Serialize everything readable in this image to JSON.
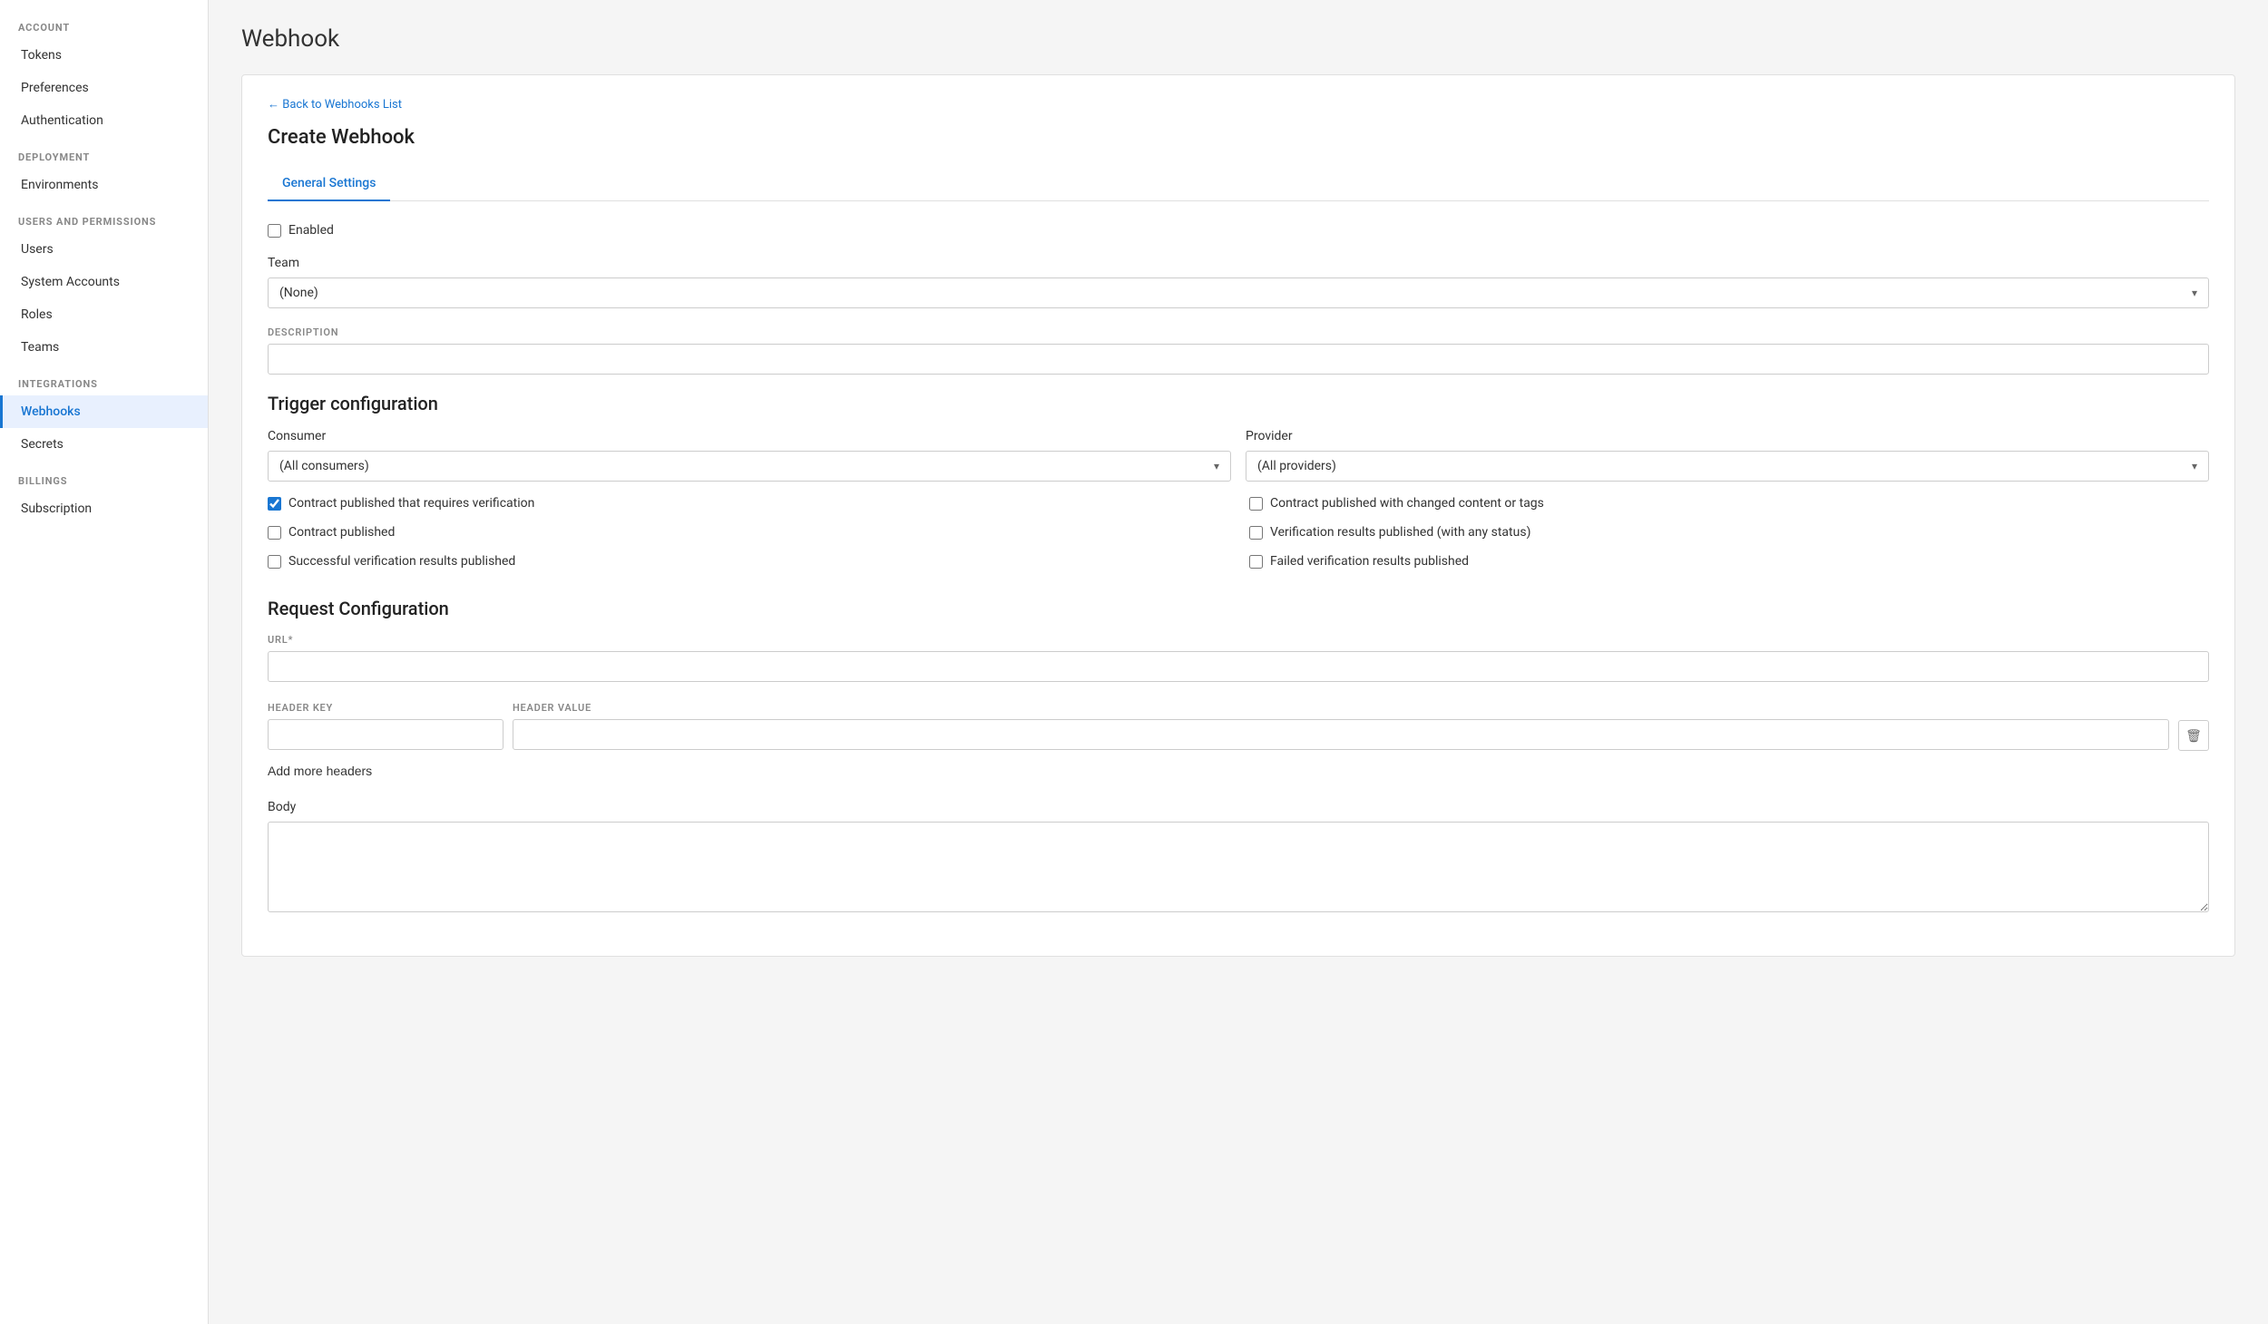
{
  "sidebar": {
    "sections": [
      {
        "label": "ACCOUNT",
        "items": [
          {
            "id": "tokens",
            "label": "Tokens",
            "active": false
          },
          {
            "id": "preferences",
            "label": "Preferences",
            "active": false
          },
          {
            "id": "authentication",
            "label": "Authentication",
            "active": false
          }
        ]
      },
      {
        "label": "DEPLOYMENT",
        "items": [
          {
            "id": "environments",
            "label": "Environments",
            "active": false
          }
        ]
      },
      {
        "label": "USERS AND PERMISSIONS",
        "items": [
          {
            "id": "users",
            "label": "Users",
            "active": false
          },
          {
            "id": "system-accounts",
            "label": "System Accounts",
            "active": false
          },
          {
            "id": "roles",
            "label": "Roles",
            "active": false
          },
          {
            "id": "teams",
            "label": "Teams",
            "active": false
          }
        ]
      },
      {
        "label": "INTEGRATIONS",
        "items": [
          {
            "id": "webhooks",
            "label": "Webhooks",
            "active": true
          },
          {
            "id": "secrets",
            "label": "Secrets",
            "active": false
          }
        ]
      },
      {
        "label": "BILLINGS",
        "items": [
          {
            "id": "subscription",
            "label": "Subscription",
            "active": false
          }
        ]
      }
    ]
  },
  "page": {
    "title": "Webhook",
    "back_link": "← Back to Webhooks List",
    "create_title": "Create Webhook"
  },
  "tabs": [
    {
      "id": "general",
      "label": "General Settings",
      "active": true
    }
  ],
  "form": {
    "enabled_label": "Enabled",
    "team_label": "Team",
    "team_value": "(None)",
    "description_label": "DESCRIPTION",
    "trigger_section": "Trigger configuration",
    "consumer_label": "Consumer",
    "consumer_value": "(All consumers)",
    "provider_label": "Provider",
    "provider_value": "(All providers)",
    "checkboxes_left": [
      {
        "id": "cb1",
        "label": "Contract published that requires verification",
        "checked": true
      },
      {
        "id": "cb2",
        "label": "Contract published",
        "checked": false
      },
      {
        "id": "cb3",
        "label": "Successful verification results published",
        "checked": false
      }
    ],
    "checkboxes_right": [
      {
        "id": "cb4",
        "label": "Contract published with changed content or tags",
        "checked": false
      },
      {
        "id": "cb5",
        "label": "Verification results published (with any status)",
        "checked": false
      },
      {
        "id": "cb6",
        "label": "Failed verification results published",
        "checked": false
      }
    ],
    "request_section": "Request Configuration",
    "url_label": "URL*",
    "header_key_label": "HEADER KEY",
    "header_value_label": "HEADER VALUE",
    "add_headers_label": "Add more headers",
    "body_label": "Body"
  },
  "icons": {
    "chevron_down": "▾",
    "trash": "🗑",
    "back_arrow": "←"
  }
}
